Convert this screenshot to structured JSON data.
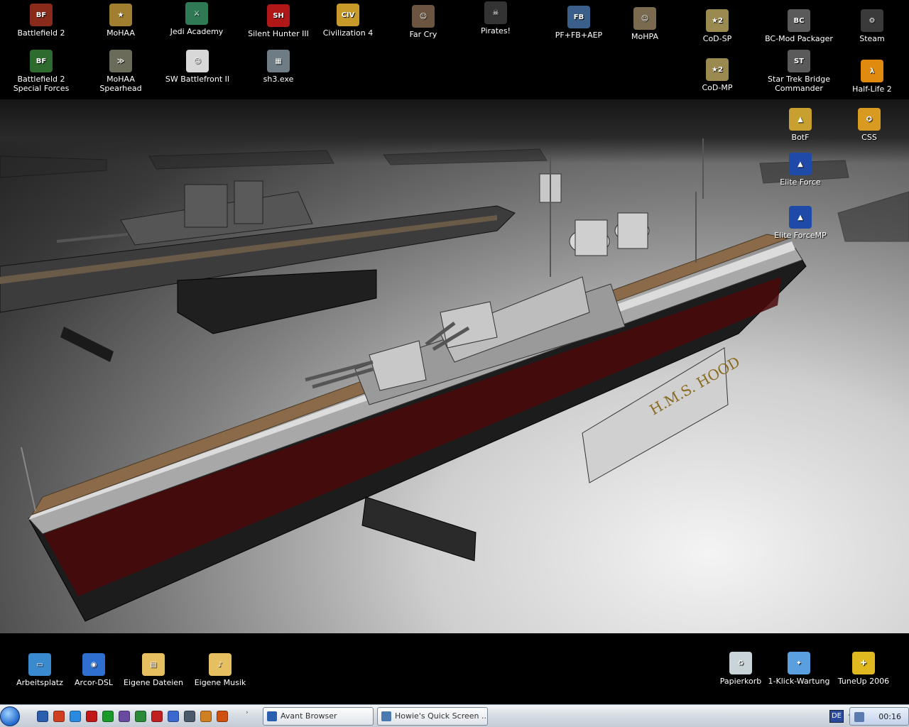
{
  "desktop_icons_top": [
    {
      "label": "Battlefield 2",
      "icon": "battlefield-2-icon",
      "color": "#8a2a1a",
      "glyph": "BF"
    },
    {
      "label": "MoHAA",
      "icon": "mohaa-star-icon",
      "color": "#a08030",
      "glyph": "★"
    },
    {
      "label": "Jedi Academy",
      "icon": "jedi-academy-icon",
      "color": "#2f7a55",
      "glyph": "⚔"
    },
    {
      "label": "Silent Hunter III",
      "icon": "silent-hunter-icon",
      "color": "#b01818",
      "glyph": "SH"
    },
    {
      "label": "Civilization 4",
      "icon": "civilization-icon",
      "color": "#c89a2a",
      "glyph": "CIV"
    },
    {
      "label": "Far Cry",
      "icon": "far-cry-icon",
      "color": "#6b5540",
      "glyph": "☺"
    },
    {
      "label": "Pirates!",
      "icon": "pirates-icon",
      "color": "#333333",
      "glyph": "☠"
    },
    {
      "label": "PF+FB+AEP",
      "icon": "pacific-fighters-icon",
      "color": "#3a5f8a",
      "glyph": "FB"
    },
    {
      "label": "MoHPA",
      "icon": "mohpa-icon",
      "color": "#7a6a50",
      "glyph": "☺"
    },
    {
      "label": "CoD-SP",
      "icon": "cod-sp-icon",
      "color": "#9a8a50",
      "glyph": "★2"
    },
    {
      "label": "BC-Mod Packager",
      "icon": "bc-mod-icon",
      "color": "#5a5a5a",
      "glyph": "BC"
    },
    {
      "label": "Steam",
      "icon": "steam-icon",
      "color": "#3a3a3a",
      "glyph": "⚙"
    }
  ],
  "desktop_icons_second": [
    {
      "label": "Battlefield 2 Special Forces",
      "icon": "bf2-special-forces-icon",
      "color": "#2e6b2e",
      "glyph": "BF"
    },
    {
      "label": "MoHAA Spearhead",
      "icon": "mohaa-spearhead-icon",
      "color": "#6b6b5a",
      "glyph": "≫"
    },
    {
      "label": "SW Battlefront II",
      "icon": "sw-battlefront-icon",
      "color": "#d8d8d8",
      "glyph": "☺"
    },
    {
      "label": "sh3.exe",
      "icon": "sh3-exe-icon",
      "color": "#6e7c86",
      "glyph": "▦"
    },
    {
      "label": "CoD-MP",
      "icon": "cod-mp-icon",
      "color": "#9a8a50",
      "glyph": "★2"
    },
    {
      "label": "Star Trek Bridge Commander",
      "icon": "star-trek-bc-icon",
      "color": "#5a5a5a",
      "glyph": "ST"
    },
    {
      "label": "Half-Life 2",
      "icon": "half-life-2-icon",
      "color": "#e08a10",
      "glyph": "λ"
    }
  ],
  "desktop_icons_right": [
    {
      "label": "BotF",
      "icon": "botf-icon",
      "color": "#c8a030",
      "glyph": "▲"
    },
    {
      "label": "CSS",
      "icon": "counter-strike-source-icon",
      "color": "#d89a20",
      "glyph": "✪"
    },
    {
      "label": "Elite Force",
      "icon": "elite-force-icon",
      "color": "#1f4aa8",
      "glyph": "▲"
    },
    {
      "label": "Elite ForceMP",
      "icon": "elite-force-mp-icon",
      "color": "#1f4aa8",
      "glyph": "▲"
    }
  ],
  "desktop_icons_bottom": [
    {
      "label": "Arbeitsplatz",
      "icon": "my-computer-icon",
      "color": "#3a8ad0",
      "glyph": "▭"
    },
    {
      "label": "Arcor-DSL",
      "icon": "globe-icon",
      "color": "#2f6fd0",
      "glyph": "◉"
    },
    {
      "label": "Eigene Dateien",
      "icon": "my-documents-icon",
      "color": "#e6c060",
      "glyph": "▤"
    },
    {
      "label": "Eigene Musik",
      "icon": "my-music-icon",
      "color": "#e6c060",
      "glyph": "♪"
    },
    {
      "label": "Papierkorb",
      "icon": "recycle-bin-icon",
      "color": "#c8d4d8",
      "glyph": "♻"
    },
    {
      "label": "1-Klick-Wartung",
      "icon": "one-click-maintenance-icon",
      "color": "#5aa0e0",
      "glyph": "✦"
    },
    {
      "label": "TuneUp 2006",
      "icon": "tuneup-icon",
      "color": "#e0b820",
      "glyph": "✚"
    }
  ],
  "wallpaper": {
    "ship_plaque": "H.M.S. HOOD",
    "colors": {
      "deck": "#8a6a48",
      "hull_dark": "#1a1a1a",
      "hull_red": "#5a0a0a",
      "hull_grey": "#9a9a9a"
    }
  },
  "taskbar": {
    "quick_launch": [
      {
        "icon": "avant-browser-icon",
        "color": "#2a5fb0"
      },
      {
        "icon": "game-launcher-icon",
        "color": "#d04020"
      },
      {
        "icon": "internet-explorer-icon",
        "color": "#2a8ae0"
      },
      {
        "icon": "acrobat-icon",
        "color": "#c01818"
      },
      {
        "icon": "clover-icon",
        "color": "#1a9a2a"
      },
      {
        "icon": "archive-icon",
        "color": "#6a4aa0"
      },
      {
        "icon": "avira-icon",
        "color": "#2a8a3a"
      },
      {
        "icon": "star-tool-icon",
        "color": "#c02020"
      },
      {
        "icon": "media-player-icon",
        "color": "#3a6ad0"
      },
      {
        "icon": "screen-icon",
        "color": "#4a5a6a"
      },
      {
        "icon": "gear-tool-icon",
        "color": "#d08020"
      },
      {
        "icon": "firefox-icon",
        "color": "#d05010"
      }
    ],
    "buttons": [
      {
        "label": "Avant Browser",
        "icon": "avant-browser-icon",
        "color": "#2a5fb0"
      },
      {
        "label": "Howie's Quick Screen ...",
        "icon": "camera-icon",
        "color": "#4a7ab0"
      }
    ],
    "language": "DE",
    "clock": "00:16"
  }
}
